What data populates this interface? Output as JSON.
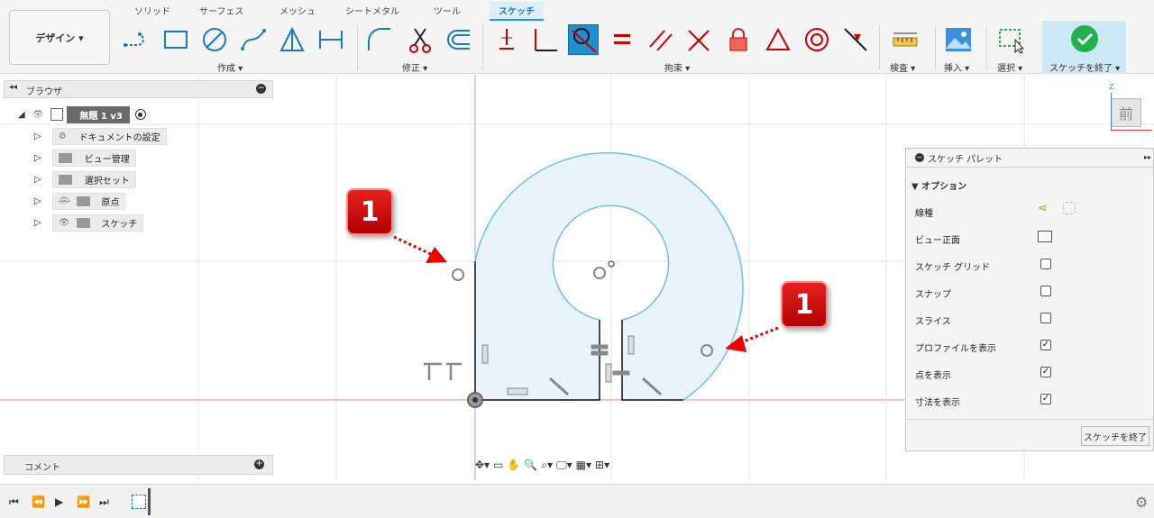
{
  "toolbar": {
    "tabs": [
      "ソリッド",
      "サーフェス",
      "メッシュ",
      "シートメタル",
      "ツール",
      "スケッチ"
    ],
    "design_button": "デザイン ▾",
    "groups": {
      "create": "作成 ▾",
      "modify": "修正 ▾",
      "constraints": "拘束 ▾",
      "inspect": "検査 ▾",
      "insert": "挿入 ▾",
      "select": "選択 ▾",
      "finish": "スケッチを終了 ▾"
    },
    "colors": {
      "tab_active": "#1a7bbf",
      "finish_bg": "#cde8f6",
      "finish_check": "#22b14c"
    }
  },
  "browser": {
    "title": "ブラウザ",
    "root": "無題 1 v3",
    "items": [
      "ドキュメントの設定",
      "ビュー管理",
      "選択セット",
      "原点",
      "スケッチ"
    ]
  },
  "comment": {
    "label": "コメント"
  },
  "viewcube": {
    "face": "前",
    "axis": "Z"
  },
  "palette": {
    "title": "スケッチ パレット",
    "section": "オプション",
    "rows": [
      {
        "label": "線種",
        "type": "icon"
      },
      {
        "label": "ビュー正面",
        "type": "icon"
      },
      {
        "label": "スケッチ グリッド",
        "checked": false
      },
      {
        "label": "スナップ",
        "checked": false
      },
      {
        "label": "スライス",
        "checked": false
      },
      {
        "label": "プロファイルを表示",
        "checked": true
      },
      {
        "label": "点を表示",
        "checked": true
      },
      {
        "label": "寸法を表示",
        "checked": true
      }
    ],
    "finish_button": "スケッチを終了"
  },
  "callouts": [
    "1",
    "1"
  ],
  "nav_icons": [
    "orbit-icon",
    "look-at-icon",
    "pan-icon",
    "zoom-icon",
    "zoom-window-icon",
    "display-settings-icon",
    "grid-settings-icon",
    "viewports-icon"
  ],
  "sketch_colors": {
    "profile_fill": "#e8f3fb",
    "curve": "#6cc3ea",
    "line": "#111111",
    "axis_red": "#e33",
    "axis_blue": "#5577ee"
  }
}
